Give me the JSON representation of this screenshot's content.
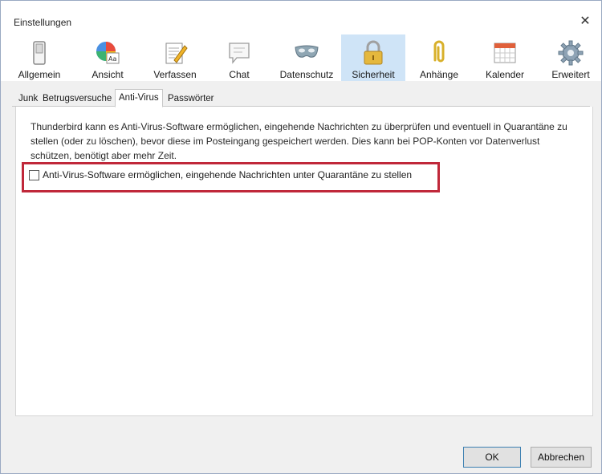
{
  "window": {
    "title": "Einstellungen",
    "close_glyph": "✕"
  },
  "toolbar": {
    "panes": [
      {
        "label": "Allgemein",
        "icon": "switch-icon"
      },
      {
        "label": "Ansicht",
        "icon": "palette-icon"
      },
      {
        "label": "Verfassen",
        "icon": "compose-icon"
      },
      {
        "label": "Chat",
        "icon": "chat-bubble-icon"
      },
      {
        "label": "Datenschutz",
        "icon": "mask-icon"
      },
      {
        "label": "Sicherheit",
        "icon": "padlock-icon"
      },
      {
        "label": "Anhänge",
        "icon": "paperclip-icon"
      },
      {
        "label": "Kalender",
        "icon": "calendar-icon"
      },
      {
        "label": "Erweitert",
        "icon": "gear-icon"
      }
    ],
    "selected": "Sicherheit"
  },
  "tabs": [
    {
      "label": "Junk"
    },
    {
      "label": "Betrugsversuche"
    },
    {
      "label": "Anti-Virus"
    },
    {
      "label": "Passwörter"
    }
  ],
  "active_tab": "Anti-Virus",
  "antivirus": {
    "description": "Thunderbird kann es Anti-Virus-Software ermöglichen, eingehende Nachrichten zu überprüfen und eventuell in Quarantäne zu stellen (oder zu löschen), bevor diese im Posteingang gespeichert werden. Dies kann bei POP-Konten vor Datenverlust schützen, benötigt aber mehr Zeit.",
    "checkbox_label": "Anti-Virus-Software ermöglichen, eingehende Nachrichten unter Quarantäne zu stellen",
    "checkbox_checked": false
  },
  "buttons": {
    "ok": "OK",
    "cancel": "Abbrechen"
  },
  "colors": {
    "highlight": "#c0283a",
    "selected_pane": "#cfe4f7"
  }
}
